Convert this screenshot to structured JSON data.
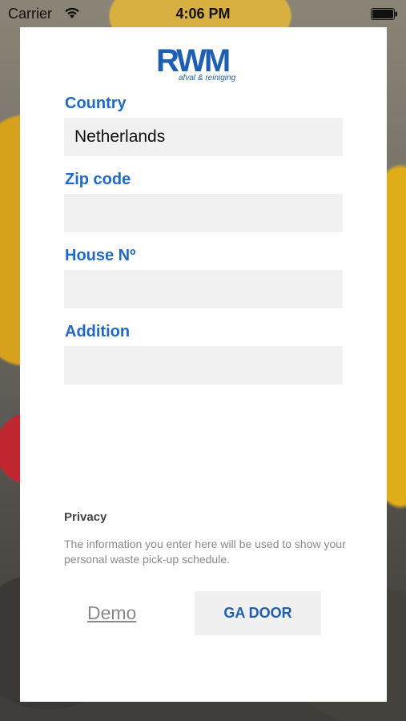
{
  "status_bar": {
    "carrier": "Carrier",
    "time": "4:06 PM",
    "wifi_icon": "wifi-icon",
    "battery_icon": "battery-icon"
  },
  "logo": {
    "text": "RWM",
    "tagline": "afval & reiniging",
    "color": "#1e5fb4"
  },
  "form": {
    "country": {
      "label": "Country",
      "value": "Netherlands"
    },
    "zip": {
      "label": "Zip code",
      "value": ""
    },
    "house": {
      "label": "House Nº",
      "value": ""
    },
    "addition": {
      "label": "Addition",
      "value": ""
    }
  },
  "privacy": {
    "title": "Privacy",
    "text": "The information you enter here will be used to show your personal waste pick-up schedule."
  },
  "actions": {
    "demo_label": "Demo",
    "go_label": "GA DOOR"
  },
  "colors": {
    "label": "#1f6ac8",
    "field_bg": "#f1f1f1",
    "button_text": "#1f5fae"
  }
}
